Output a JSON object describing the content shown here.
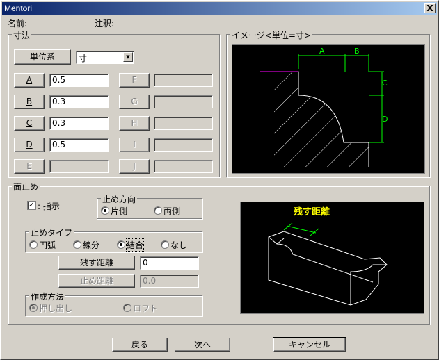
{
  "window": {
    "title": "Mentori",
    "close": "X"
  },
  "header": {
    "name_label": "名前:",
    "note_label": "注釈:"
  },
  "dimensions": {
    "group_label": "寸法",
    "unit_button": "単位系",
    "unit_value": "寸",
    "params": [
      {
        "label": "A",
        "value": "0.5",
        "enabled": true
      },
      {
        "label": "B",
        "value": "0.3",
        "enabled": true
      },
      {
        "label": "C",
        "value": "0.3",
        "enabled": true
      },
      {
        "label": "D",
        "value": "0.5",
        "enabled": true
      },
      {
        "label": "E",
        "value": "",
        "enabled": false
      },
      {
        "label": "F",
        "value": "",
        "enabled": false
      },
      {
        "label": "G",
        "value": "",
        "enabled": false
      },
      {
        "label": "H",
        "value": "",
        "enabled": false
      },
      {
        "label": "I",
        "value": "",
        "enabled": false
      },
      {
        "label": "J",
        "value": "",
        "enabled": false
      }
    ]
  },
  "image": {
    "group_label": "イメージ<単位=寸>",
    "labels": {
      "a": "A",
      "b": "B",
      "c": "C",
      "d": "D"
    }
  },
  "chamfer": {
    "group_label": "面止め",
    "indicate_label": ": 指示",
    "indicate_checked": true,
    "direction": {
      "label": "止め方向",
      "options": [
        "片側",
        "両側"
      ],
      "selected": "片側"
    },
    "stop_type": {
      "label": "止めタイプ",
      "options": [
        "円弧",
        "線分",
        "結合",
        "なし"
      ],
      "selected": "結合"
    },
    "remain_distance": {
      "button": "残す距離",
      "value": "0"
    },
    "stop_distance": {
      "button": "止め距離",
      "value": "0.0"
    },
    "method": {
      "label": "作成方法",
      "options": [
        "押し出し",
        "ロフト"
      ],
      "selected": "押し出し"
    },
    "preview_label": "残す距離"
  },
  "footer": {
    "back": "戻る",
    "next": "次へ",
    "cancel": "キャンセル"
  },
  "colors": {
    "title_start": "#0a246a",
    "title_end": "#a6caf0",
    "face": "#d4d0c8",
    "dim_green": "#00ff00",
    "label_yellow": "#ffff00",
    "magenta": "#ff00ff"
  }
}
